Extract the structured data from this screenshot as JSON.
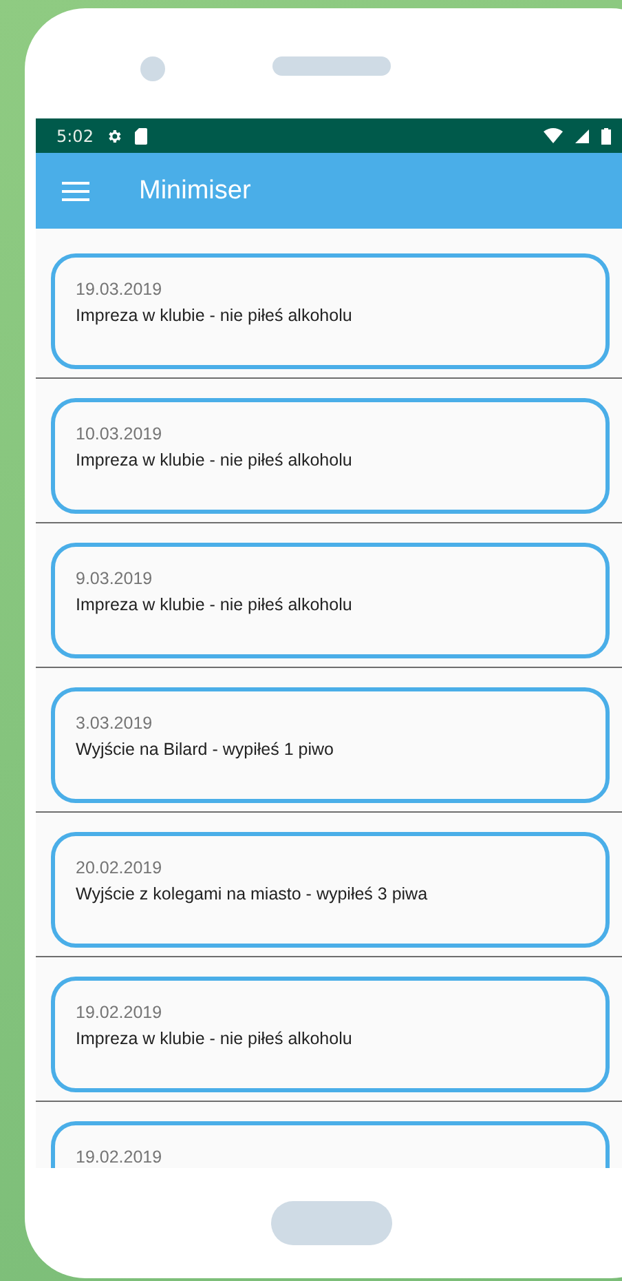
{
  "status_bar": {
    "time": "5:02"
  },
  "app_bar": {
    "title": "Minimiser"
  },
  "entries": [
    {
      "date": "19.03.2019",
      "description": "Impreza w klubie - nie piłeś alkoholu"
    },
    {
      "date": "10.03.2019",
      "description": "Impreza w klubie - nie piłeś alkoholu"
    },
    {
      "date": "9.03.2019",
      "description": "Impreza w klubie - nie piłeś alkoholu"
    },
    {
      "date": "3.03.2019",
      "description": "Wyjście na Bilard - wypiłeś 1 piwo"
    },
    {
      "date": "20.02.2019",
      "description": "Wyjście z kolegami na miasto - wypiłeś 3 piwa"
    },
    {
      "date": "19.02.2019",
      "description": "Impreza w klubie - nie piłeś alkoholu"
    },
    {
      "date": "19.02.2019"
    }
  ]
}
